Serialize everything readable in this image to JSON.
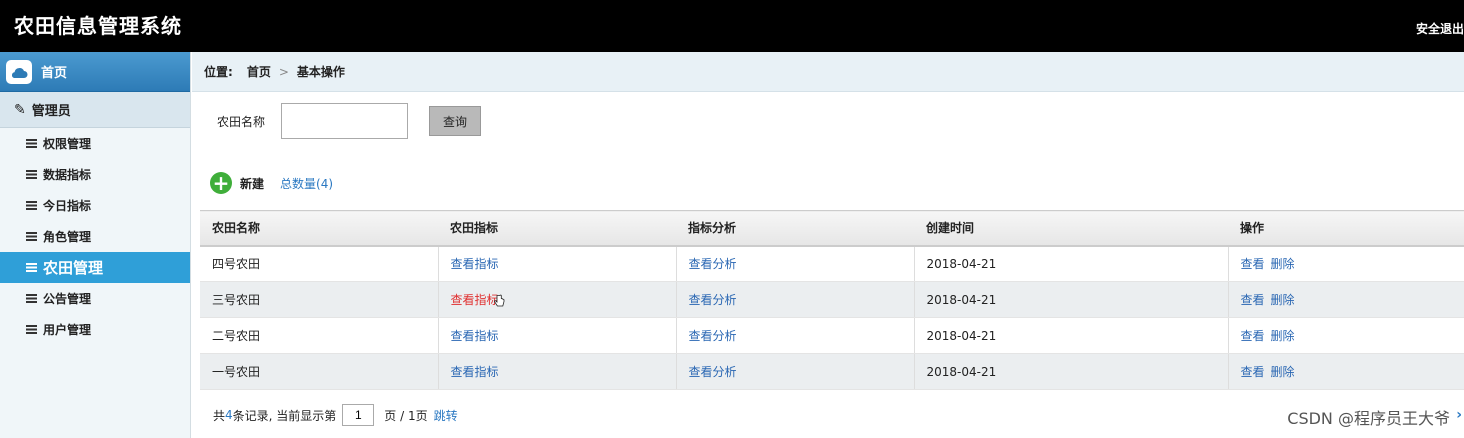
{
  "header": {
    "title": "农田信息管理系统",
    "logout_label": "安全退出"
  },
  "sidebar": {
    "home_label": "首页",
    "group_label": "管理员",
    "items": [
      {
        "label": "权限管理"
      },
      {
        "label": "数据指标"
      },
      {
        "label": "今日指标"
      },
      {
        "label": "角色管理"
      },
      {
        "label": "农田管理",
        "active": true
      },
      {
        "label": "公告管理"
      },
      {
        "label": "用户管理"
      }
    ]
  },
  "breadcrumb": {
    "location_label": "位置:",
    "home": "首页",
    "separator": ">",
    "current": "基本操作"
  },
  "search": {
    "label": "农田名称",
    "value": "",
    "button_label": "查询"
  },
  "toolbar": {
    "new_label": "新建",
    "total_label": "总数量(4)"
  },
  "table": {
    "columns": [
      "农田名称",
      "农田指标",
      "指标分析",
      "创建时间",
      "操作"
    ],
    "rows": [
      {
        "name": "四号农田",
        "indicator": "查看指标",
        "analysis": "查看分析",
        "created": "2018-04-21",
        "view": "查看",
        "delete": "删除"
      },
      {
        "name": "三号农田",
        "indicator": "查看指标",
        "analysis": "查看分析",
        "created": "2018-04-21",
        "view": "查看",
        "delete": "删除"
      },
      {
        "name": "二号农田",
        "indicator": "查看指标",
        "analysis": "查看分析",
        "created": "2018-04-21",
        "view": "查看",
        "delete": "删除"
      },
      {
        "name": "一号农田",
        "indicator": "查看指标",
        "analysis": "查看分析",
        "created": "2018-04-21",
        "view": "查看",
        "delete": "删除"
      }
    ]
  },
  "pager": {
    "prefix": "共",
    "count": "4",
    "suffix": "条记录,  当前显示第",
    "page_value": "1",
    "page_of": "页 / 1页",
    "jump_label": "跳转"
  },
  "watermark": "CSDN @程序员王大爷",
  "colors": {
    "accent": "#2f9fd8",
    "link": "#2a67b3",
    "hover": "#e03030"
  }
}
